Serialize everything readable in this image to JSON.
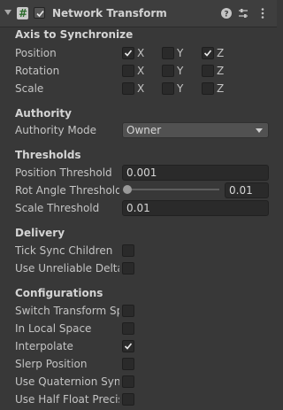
{
  "component": {
    "title": "Network Transform",
    "enabled": true,
    "script_icon": "csharp-script-icon",
    "header_icons": [
      "help-icon",
      "preset-icon",
      "more-icon"
    ]
  },
  "sections": {
    "axis": "Axis to Synchronize",
    "authority": "Authority",
    "thresholds": "Thresholds",
    "delivery": "Delivery",
    "configurations": "Configurations"
  },
  "axis": {
    "letters": {
      "x": "X",
      "y": "Y",
      "z": "Z"
    },
    "position": {
      "label": "Position",
      "x": true,
      "y": false,
      "z": true
    },
    "rotation": {
      "label": "Rotation",
      "x": false,
      "y": false,
      "z": false
    },
    "scale": {
      "label": "Scale",
      "x": false,
      "y": false,
      "z": false
    }
  },
  "authority": {
    "mode_label": "Authority Mode",
    "mode_value": "Owner"
  },
  "thresholds": {
    "position_label": "Position Threshold",
    "position_value": "0.001",
    "rot_angle_label": "Rot Angle Threshold",
    "rot_angle_value": "0.01",
    "rot_angle_slider_fraction": 0,
    "scale_label": "Scale Threshold",
    "scale_value": "0.01"
  },
  "delivery": {
    "tick_sync_label": "Tick Sync Children",
    "tick_sync": false,
    "unreliable_label": "Use Unreliable Deltas",
    "unreliable": false
  },
  "configurations": {
    "switch_label": "Switch Transform Space When Parented",
    "switch": false,
    "local_label": "In Local Space",
    "local": false,
    "interpolate_label": "Interpolate",
    "interpolate": true,
    "slerp_label": "Slerp Position",
    "slerp": false,
    "quaternion_label": "Use Quaternion Synchronization",
    "quaternion": false,
    "half_float_label": "Use Half Float Precision",
    "half_float": false
  },
  "colors": {
    "background": "#383838",
    "header": "#3e3e3e",
    "field": "#2a2a2a",
    "text": "#c4c4c4"
  }
}
